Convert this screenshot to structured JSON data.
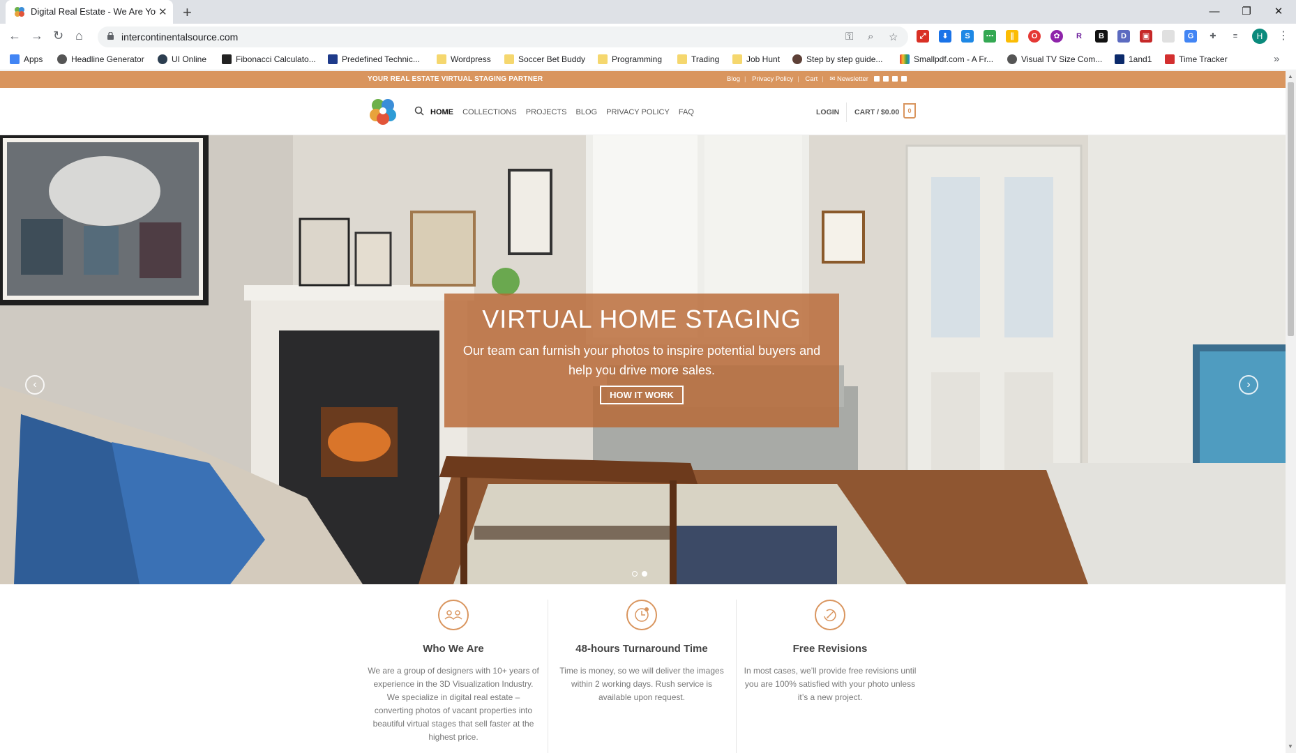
{
  "browser": {
    "tab_title": "Digital Real Estate - We Are Your",
    "url": "intercontinentalsource.com",
    "new_tab_icon": "plus-icon",
    "window_controls": [
      "minimize-icon",
      "maximize-icon",
      "close-icon"
    ],
    "profile_initial": "H"
  },
  "bookmarks": [
    {
      "label": "Apps",
      "icon": "apps-grid-icon"
    },
    {
      "label": "Headline Generator",
      "icon": "globe-icon"
    },
    {
      "label": "UI Online",
      "icon": "target-icon"
    },
    {
      "label": "Fibonacci Calculato...",
      "icon": "inv-icon"
    },
    {
      "label": "Predefined Technic...",
      "icon": "page-icon"
    },
    {
      "label": "Wordpress",
      "icon": "folder-icon"
    },
    {
      "label": "Soccer Bet Buddy",
      "icon": "folder-icon"
    },
    {
      "label": "Programming",
      "icon": "folder-icon"
    },
    {
      "label": "Trading",
      "icon": "folder-icon"
    },
    {
      "label": "Job Hunt",
      "icon": "folder-icon"
    },
    {
      "label": "Step by step guide...",
      "icon": "globe-icon"
    },
    {
      "label": "Smallpdf.com - A Fr...",
      "icon": "smallpdf-icon"
    },
    {
      "label": "Visual TV Size Com...",
      "icon": "globe-icon"
    },
    {
      "label": "1and1",
      "icon": "1and1-icon"
    },
    {
      "label": "Time Tracker",
      "icon": "pdf-icon"
    }
  ],
  "site": {
    "topbar": {
      "tagline": "YOUR REAL ESTATE VIRTUAL STAGING PARTNER",
      "links": [
        "Blog",
        "Privacy Policy",
        "Cart",
        "Newsletter"
      ]
    },
    "nav": {
      "items": [
        "HOME",
        "COLLECTIONS",
        "PROJECTS",
        "BLOG",
        "PRIVACY POLICY",
        "FAQ"
      ],
      "active": "HOME",
      "login": "LOGIN",
      "cart": "CART / $0.00",
      "cart_count": "0"
    },
    "hero": {
      "title": "VIRTUAL HOME STAGING",
      "subtitle": "Our team can furnish your photos to inspire potential buyers and help you drive more sales.",
      "button": "HOW IT WORK",
      "slides": 2,
      "active_slide": 2
    },
    "features": [
      {
        "icon": "people-icon",
        "title": "Who We Are",
        "text": "We are a group of designers with 10+ years of experience in the 3D Visualization Industry. We specialize in digital real estate – converting photos of vacant properties into beautiful virtual stages that sell faster at the highest price."
      },
      {
        "icon": "clock-icon",
        "title": "48-hours Turnaround Time",
        "text": "Time is money, so we will deliver the images within 2 working days. Rush service is available upon request."
      },
      {
        "icon": "revision-icon",
        "title": "Free Revisions",
        "text": "In most cases, we’ll provide free revisions until you are 100% satisfied with your photo unless it’s a new project."
      }
    ]
  },
  "colors": {
    "accent": "#d9955e",
    "hero_overlay": "#b86834"
  }
}
